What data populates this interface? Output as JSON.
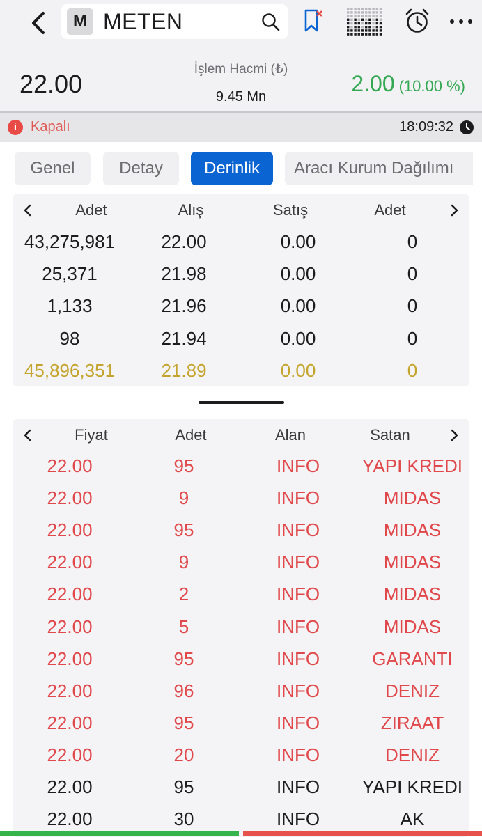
{
  "header": {
    "badge": "M",
    "symbol": "METEN"
  },
  "price": {
    "last": "22.00",
    "volume_label": "İşlem Hacmi (₺)",
    "volume_value": "9.45 Mn",
    "change_abs": "2.00",
    "change_pct": "(10.00 %)",
    "change_color": "#34a853"
  },
  "status": {
    "text": "Kapalı",
    "time": "18:09:32"
  },
  "tabs": [
    {
      "label": "Genel",
      "active": false
    },
    {
      "label": "Detay",
      "active": false
    },
    {
      "label": "Derinlik",
      "active": true
    },
    {
      "label": "Aracı Kurum Dağılımı",
      "active": false
    }
  ],
  "depth": {
    "headers": [
      "Adet",
      "Alış",
      "Satış",
      "Adet"
    ],
    "rows": [
      [
        "43,275,981",
        "22.00",
        "0.00",
        "0"
      ],
      [
        "25,371",
        "21.98",
        "0.00",
        "0"
      ],
      [
        "1,133",
        "21.96",
        "0.00",
        "0"
      ],
      [
        "98",
        "21.94",
        "0.00",
        "0"
      ]
    ],
    "total": [
      "45,896,351",
      "21.89",
      "0.00",
      "0"
    ]
  },
  "trades": {
    "headers": [
      "Fiyat",
      "Adet",
      "Alan",
      "Satan"
    ],
    "rows": [
      {
        "price": "22.00",
        "qty": "95",
        "buyer": "INFO",
        "seller": "YAPI KREDI",
        "tone": "red"
      },
      {
        "price": "22.00",
        "qty": "9",
        "buyer": "INFO",
        "seller": "MIDAS",
        "tone": "red"
      },
      {
        "price": "22.00",
        "qty": "95",
        "buyer": "INFO",
        "seller": "MIDAS",
        "tone": "red"
      },
      {
        "price": "22.00",
        "qty": "9",
        "buyer": "INFO",
        "seller": "MIDAS",
        "tone": "red"
      },
      {
        "price": "22.00",
        "qty": "2",
        "buyer": "INFO",
        "seller": "MIDAS",
        "tone": "red"
      },
      {
        "price": "22.00",
        "qty": "5",
        "buyer": "INFO",
        "seller": "MIDAS",
        "tone": "red"
      },
      {
        "price": "22.00",
        "qty": "95",
        "buyer": "INFO",
        "seller": "GARANTI",
        "tone": "red"
      },
      {
        "price": "22.00",
        "qty": "96",
        "buyer": "INFO",
        "seller": "DENIZ",
        "tone": "red"
      },
      {
        "price": "22.00",
        "qty": "95",
        "buyer": "INFO",
        "seller": "ZIRAAT",
        "tone": "red"
      },
      {
        "price": "22.00",
        "qty": "20",
        "buyer": "INFO",
        "seller": "DENIZ",
        "tone": "red"
      },
      {
        "price": "22.00",
        "qty": "95",
        "buyer": "INFO",
        "seller": "YAPI KREDI",
        "tone": "black"
      },
      {
        "price": "22.00",
        "qty": "30",
        "buyer": "INFO",
        "seller": "AK",
        "tone": "black"
      }
    ]
  },
  "colors": {
    "accent": "#0a64d2",
    "sell": "#e0484b",
    "total": "#c4a42c",
    "closed": "#e84a45"
  },
  "icons": [
    "back-icon",
    "search-icon",
    "bookmark-remove-icon",
    "depth-grid-icon",
    "alarm-clock-icon",
    "more-icon",
    "info-icon",
    "clock-icon",
    "chevron-left-icon",
    "chevron-right-icon"
  ]
}
